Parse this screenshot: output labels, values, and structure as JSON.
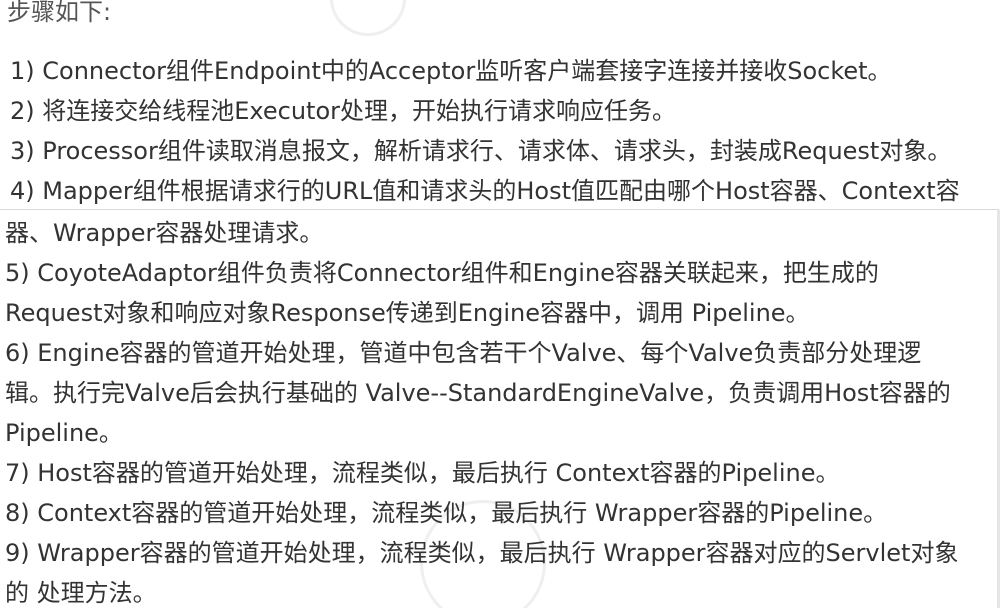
{
  "doc": {
    "heading": "步骤如下:",
    "lines": [
      "1) Connector组件Endpoint中的Acceptor监听客户端套接字连接并接收Socket。",
      "2) 将连接交给线程池Executor处理，开始执行请求响应任务。",
      "3) Processor组件读取消息报文，解析请求行、请求体、请求头，封装成Request对象。",
      "4) Mapper组件根据请求行的URL值和请求头的Host值匹配由哪个Host容器、Context容",
      "器、Wrapper容器处理请求。",
      "5) CoyoteAdaptor组件负责将Connector组件和Engine容器关联起来，把生成的",
      "Request对象和响应对象Response传递到Engine容器中，调用 Pipeline。",
      "6) Engine容器的管道开始处理，管道中包含若干个Valve、每个Valve负责部分处理逻",
      "辑。执行完Valve后会执行基础的 Valve--StandardEngineValve，负责调用Host容器的",
      "Pipeline。",
      "7) Host容器的管道开始处理，流程类似，最后执行 Context容器的Pipeline。",
      "8) Context容器的管道开始处理，流程类似，最后执行 Wrapper容器的Pipeline。",
      "9) Wrapper容器的管道开始处理，流程类似，最后执行 Wrapper容器对应的Servlet对象",
      "的 处理方法。"
    ]
  }
}
